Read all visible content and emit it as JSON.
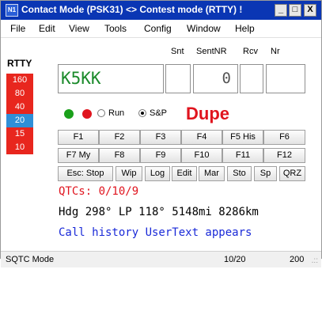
{
  "window": {
    "title": "Contact Mode (PSK31) <> Contest mode (RTTY) !",
    "app_icon": "N1",
    "min_label": "_",
    "max_label": "□",
    "close_label": "X"
  },
  "menu": [
    "File",
    "Edit",
    "View",
    "Tools",
    "Config",
    "Window",
    "Help"
  ],
  "mode_label": "RTTY",
  "bands": [
    "160",
    "80",
    "40",
    "20",
    "15",
    "10"
  ],
  "selected_band": "20",
  "fields": {
    "snt_label": "Snt",
    "sentnr_label": "SentNR",
    "rcv_label": "Rcv",
    "nr_label": "Nr",
    "call_value": "K5KK",
    "snt_value": "",
    "sentnr_value": "0",
    "rcv_value": "",
    "nr_value": ""
  },
  "status_dots": {
    "green": "#1aa01a",
    "red": "#e0141e"
  },
  "radio": {
    "run_label": "Run",
    "sp_label": "S&P",
    "selected": "S&P"
  },
  "dupe_text": "Dupe",
  "fkeys_row1": [
    "F1",
    "F2",
    "F3",
    "F4",
    "F5 His",
    "F6"
  ],
  "fkeys_row2": [
    "F7 My",
    "F8",
    "F9",
    "F10",
    "F11",
    "F12"
  ],
  "buttons_row3": [
    "Esc: Stop",
    "Wip",
    "Log",
    "Edit",
    "Mar",
    "Sto",
    "Sp",
    "QRZ"
  ],
  "info": {
    "qtcs": "QTCs: 0/10/9",
    "heading": "Hdg 298° LP 118° 5148mi 8286km",
    "call_history": "Call history UserText appears"
  },
  "status": {
    "mode": "SQTC Mode",
    "count": "10/20",
    "value": "200"
  },
  "colors": {
    "titlebar": "#0a36b4",
    "band_red": "#e8261e",
    "band_selected": "#2f8fd8",
    "dupe": "#e0141e"
  }
}
